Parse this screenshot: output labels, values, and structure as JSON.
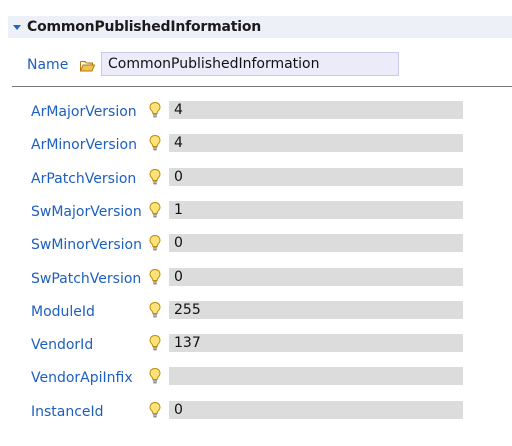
{
  "section": {
    "title": "CommonPublishedInformation"
  },
  "name_field": {
    "label": "Name",
    "value": "CommonPublishedInformation"
  },
  "params": [
    {
      "label": "ArMajorVersion",
      "value": "4"
    },
    {
      "label": "ArMinorVersion",
      "value": "4"
    },
    {
      "label": "ArPatchVersion",
      "value": "0"
    },
    {
      "label": "SwMajorVersion",
      "value": "1"
    },
    {
      "label": "SwMinorVersion",
      "value": "0"
    },
    {
      "label": "SwPatchVersion",
      "value": "0"
    },
    {
      "label": "ModuleId",
      "value": "255"
    },
    {
      "label": "VendorId",
      "value": "137"
    },
    {
      "label": "VendorApiInfix",
      "value": ""
    },
    {
      "label": "InstanceId",
      "value": "0"
    }
  ],
  "icons": {
    "collapse": "triangle-down-icon",
    "folder": "folder-open-icon",
    "param": "lightbulb-icon"
  },
  "colors": {
    "label": "#1d5fbe",
    "field_bg": "#dcdcdc",
    "header_bg": "#eef0f7",
    "accent": "#1d66c5"
  }
}
